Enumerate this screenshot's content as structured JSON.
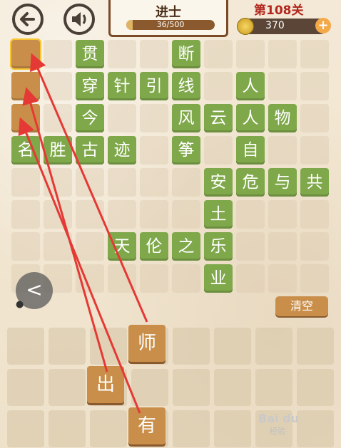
{
  "header": {
    "rank": "进士",
    "progress_text": "36/500",
    "progress_fraction": 0.072,
    "level": "第108关",
    "coins": "370",
    "plus": "+"
  },
  "board": {
    "tiles": [
      {
        "char": "贯",
        "r": 0,
        "c": 2
      },
      {
        "char": "断",
        "r": 0,
        "c": 5
      },
      {
        "char": "穿",
        "r": 1,
        "c": 2
      },
      {
        "char": "针",
        "r": 1,
        "c": 3
      },
      {
        "char": "引",
        "r": 1,
        "c": 4
      },
      {
        "char": "线",
        "r": 1,
        "c": 5
      },
      {
        "char": "人",
        "r": 1,
        "c": 7
      },
      {
        "char": "今",
        "r": 2,
        "c": 2
      },
      {
        "char": "风",
        "r": 2,
        "c": 5
      },
      {
        "char": "云",
        "r": 2,
        "c": 6
      },
      {
        "char": "人",
        "r": 2,
        "c": 7
      },
      {
        "char": "物",
        "r": 2,
        "c": 8
      },
      {
        "char": "名",
        "r": 3,
        "c": 0
      },
      {
        "char": "胜",
        "r": 3,
        "c": 1
      },
      {
        "char": "古",
        "r": 3,
        "c": 2
      },
      {
        "char": "迹",
        "r": 3,
        "c": 3
      },
      {
        "char": "筝",
        "r": 3,
        "c": 5
      },
      {
        "char": "自",
        "r": 3,
        "c": 7
      },
      {
        "char": "安",
        "r": 4,
        "c": 6
      },
      {
        "char": "危",
        "r": 4,
        "c": 7
      },
      {
        "char": "与",
        "r": 4,
        "c": 8
      },
      {
        "char": "共",
        "r": 4,
        "c": 9
      },
      {
        "char": "土",
        "r": 5,
        "c": 6
      },
      {
        "char": "天",
        "r": 6,
        "c": 3
      },
      {
        "char": "伦",
        "r": 6,
        "c": 4
      },
      {
        "char": "之",
        "r": 6,
        "c": 5
      },
      {
        "char": "乐",
        "r": 6,
        "c": 6
      },
      {
        "char": "业",
        "r": 7,
        "c": 6
      }
    ],
    "blanks": [
      {
        "r": 0,
        "c": 0,
        "selected": true
      },
      {
        "r": 1,
        "c": 0,
        "selected": false
      },
      {
        "r": 2,
        "c": 0,
        "selected": false
      }
    ]
  },
  "controls": {
    "collapse": "<",
    "clear": "清空"
  },
  "choices": [
    {
      "char": "师",
      "r": 0,
      "c": 3
    },
    {
      "char": "出",
      "r": 1,
      "c": 2
    },
    {
      "char": "有",
      "r": 2,
      "c": 3
    }
  ],
  "watermark": {
    "brand": "Bai du",
    "sub": "经验"
  },
  "colors": {
    "green_tile": "#7fa84a",
    "brown_tile": "#c98f4a",
    "arrow": "#e53935",
    "level_red": "#b2261d"
  }
}
